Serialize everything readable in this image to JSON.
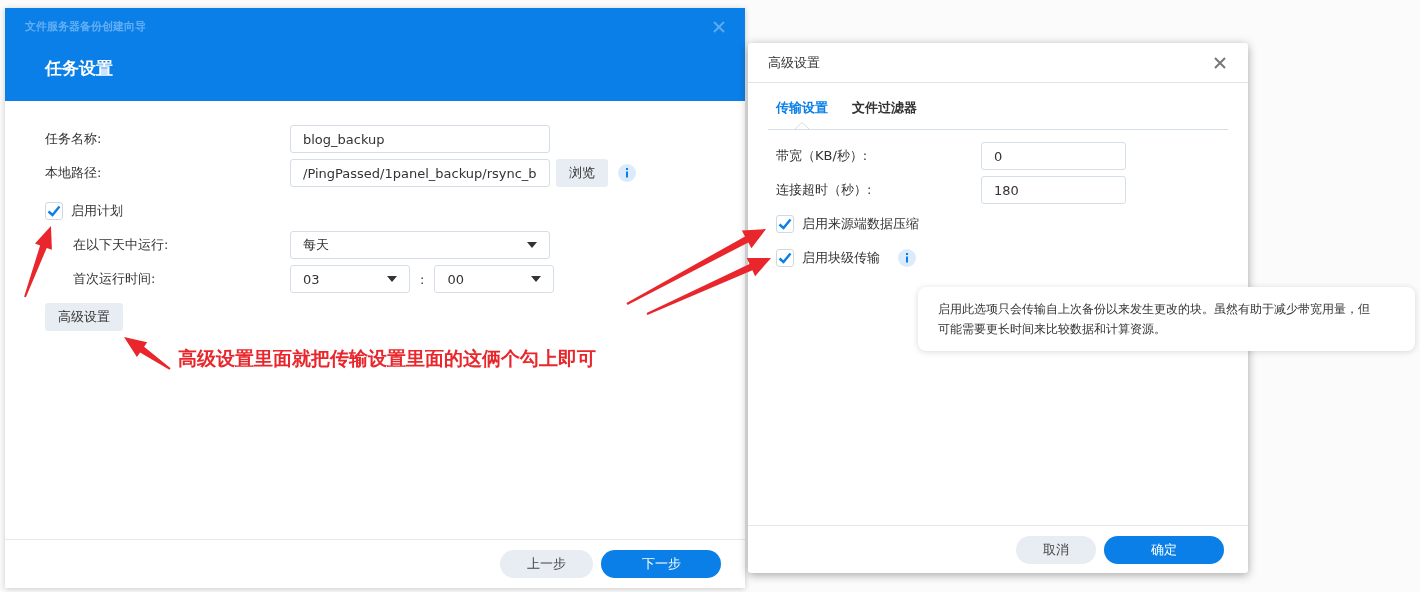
{
  "wizard": {
    "title": "文件服务器备份创建向导",
    "heading": "任务设置",
    "fields": [
      {
        "kind": "text",
        "label": "任务名称:",
        "value": "blog_backup"
      },
      {
        "kind": "path",
        "label": "本地路径:",
        "value": "/PingPassed/1panel_backup/rsync_b",
        "button": "浏览"
      }
    ],
    "schedule": {
      "label": "启用计划",
      "checked": true
    },
    "schedule_fields": [
      {
        "kind": "select",
        "label": "在以下天中运行:",
        "value": "每天"
      },
      {
        "kind": "time",
        "label": "首次运行时间:",
        "hour": "03",
        "separator": ":",
        "minute": "00"
      }
    ],
    "advanced_button": "高级设置",
    "buttons": [
      {
        "kind": "secondary",
        "label": "上一步"
      },
      {
        "kind": "primary",
        "label": "下一步"
      }
    ]
  },
  "advanced": {
    "title": "高级设置",
    "tabs": [
      {
        "label": "传输设置",
        "selected": true
      },
      {
        "label": "文件过滤器",
        "selected": false
      }
    ],
    "fields": [
      {
        "label": "带宽（KB/秒）:",
        "value": "0"
      },
      {
        "label": "连接超时（秒）:",
        "value": "180"
      }
    ],
    "options": [
      {
        "label": "启用来源端数据压缩",
        "checked": true,
        "info": false
      },
      {
        "label": "启用块级传输",
        "checked": true,
        "info": true
      }
    ],
    "buttons": [
      {
        "kind": "secondary",
        "label": "取消"
      },
      {
        "kind": "primary",
        "label": "确定"
      }
    ]
  },
  "tooltip": "启用此选项只会传输自上次备份以来发生更改的块。虽然有助于减少带宽用量，但可能需要更长时间来比较数据和计算资源。",
  "annotation": "高级设置里面就把传输设置里面的这俩个勾上即可"
}
